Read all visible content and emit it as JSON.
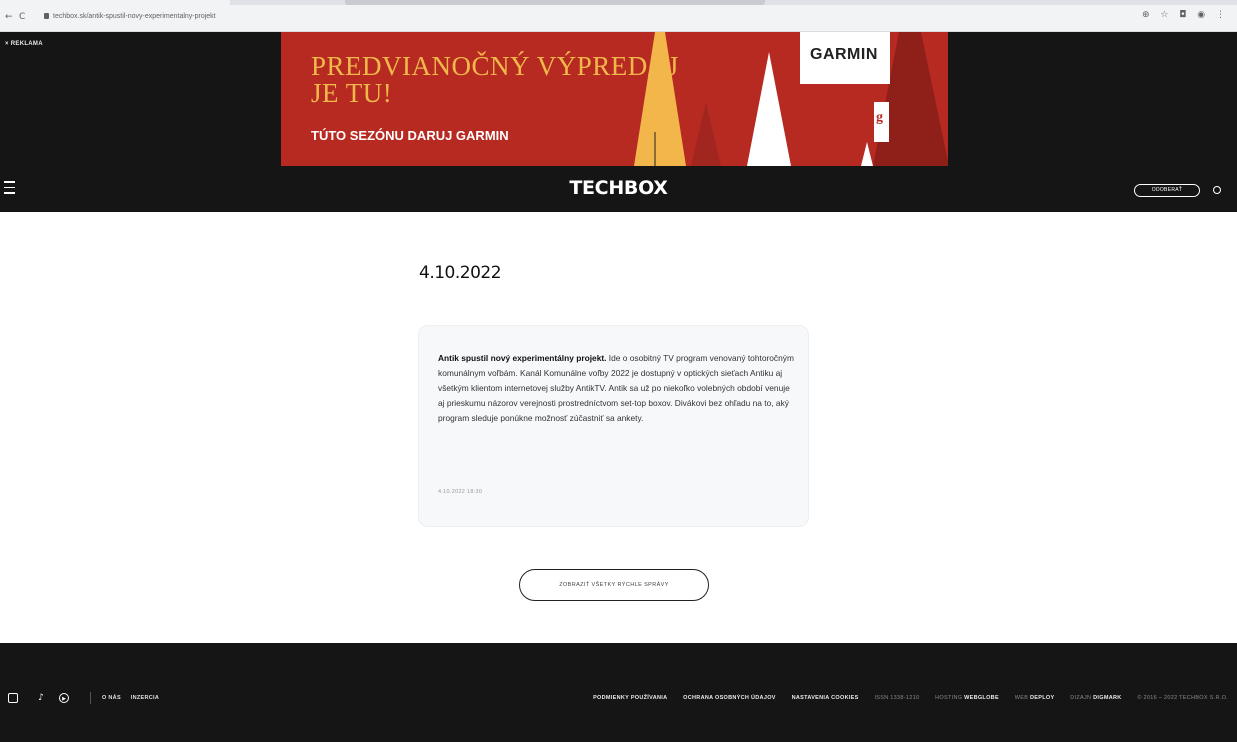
{
  "browser": {
    "url": "techbox.sk/antik-spustil-novy-experimentalny-projekt",
    "nav_back": "←",
    "nav_reload": "C",
    "toolbar_icons": "⊕ ☆ ◘ ◉ ⋮"
  },
  "ad": {
    "label": "× REKLAMA",
    "title": "PREDVIANOČNÝ VÝPREDAJ\nJE TU!",
    "subtitle": "TÚTO SEZÓNU DARUJ GARMIN",
    "brand": "GARMIN",
    "tag_letter": "g",
    "colors": {
      "background": "#b72a22",
      "title": "#f0b84b"
    }
  },
  "header": {
    "logo": "TECHBOX",
    "subscribe_label": "ODOBERAŤ"
  },
  "main": {
    "date": "4.10.2022",
    "card": {
      "lead": "Antik spustil nový experimentálny projekt.",
      "body": " Ide o osobitný TV program venovaný tohtoročným komunálnym voľbám. Kanál Komunálne voľby 2022 je dostupný v optických sieťach Antiku aj všetkým klientom internetovej služby AntikTV. Antik sa už po niekoľko volebných období venuje aj prieskumu názorov verejnosti prostredníctvom set-top boxov. Divákovi bez ohľadu na to, aký program sleduje ponúkne možnosť zúčastniť sa ankety.",
      "timestamp": "4.10.2022 18:30"
    },
    "show_all_label": "ZOBRAZIŤ VŠETKY RÝCHLE SPRÁVY"
  },
  "footer": {
    "left_links": [
      "O NÁS",
      "INZERCIA"
    ],
    "right_links": [
      "PODMIENKY POUŽÍVANIA",
      "OCHRANA OSOBNÝCH ÚDAJOV",
      "NASTAVENIA COOKIES"
    ],
    "issn": "ISSN 1338-1210",
    "hosting_prefix": "HOSTING",
    "hosting_name": "WEBGLOBE",
    "web_prefix": "WEB",
    "web_name": "DEPLOY",
    "design_prefix": "DIZAJN",
    "design_name": "DIGMARK",
    "copyright": "© 2016 – 2022 TECHBOX S.R.O."
  }
}
